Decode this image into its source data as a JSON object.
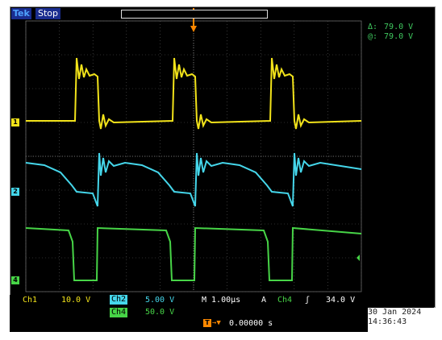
{
  "header": {
    "brand": "Tek",
    "acq_state": "Stop"
  },
  "cursors": {
    "delta_symbol": "Δ:",
    "delta_value": "79.0 V",
    "at_symbol": "@:",
    "at_value": "79.0 V"
  },
  "channels": [
    {
      "id": "1",
      "label": "Ch1",
      "scale": "10.0 V",
      "color": "#f2e31a"
    },
    {
      "id": "2",
      "label": "Ch2",
      "scale": "5.00 V",
      "color": "#45d6ea"
    },
    {
      "id": "4",
      "label": "Ch4",
      "scale": "50.0 V",
      "color": "#47d447"
    }
  ],
  "timebase": {
    "label": "M 1.00µs"
  },
  "trigger": {
    "mode": "A",
    "source": "Ch4",
    "slope": "ʃ",
    "level": "34.0 V",
    "position_icon": "T",
    "position_value": "0.00000 s"
  },
  "datetime": {
    "date": "30 Jan  2024",
    "time": "14:36:43"
  },
  "colors": {
    "grid": "#5a5a5a",
    "trigger": "#ff8800",
    "readout": "#3fc95f",
    "brand_bg": "#1a2d8f"
  },
  "icons": {
    "trigger_marker": "trigger-arrow-icon",
    "ch4_level_marker": "trigger-level-arrow-icon"
  }
}
